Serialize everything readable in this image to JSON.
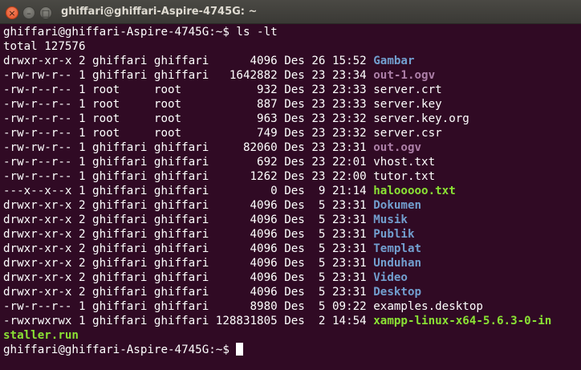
{
  "window": {
    "title": "ghiffari@ghiffari-Aspire-4745G: ~",
    "close_glyph": "×",
    "minimize_glyph": "–",
    "maximize_glyph": "□"
  },
  "colors": {
    "background": "#300a24",
    "text": "#ffffff",
    "directory": "#729fcf",
    "media": "#ad7fa8",
    "executable": "#8ae234"
  },
  "terminal": {
    "prompt": "ghiffari@ghiffari-Aspire-4745G:~$ ",
    "command_line": "ghiffari@ghiffari-Aspire-4745G:~$ ls -lt",
    "total_line": "total 127576",
    "rows": [
      {
        "info": "drwxr-xr-x 2 ghiffari ghiffari      4096 Des 26 15:52 ",
        "name": "Gambar",
        "kind": "dir"
      },
      {
        "info": "-rw-rw-r-- 1 ghiffari ghiffari   1642882 Des 23 23:34 ",
        "name": "out-1.ogv",
        "kind": "media"
      },
      {
        "info": "-rw-r--r-- 1 root     root           932 Des 23 23:33 ",
        "name": "server.crt",
        "kind": "plain"
      },
      {
        "info": "-rw-r--r-- 1 root     root           887 Des 23 23:33 ",
        "name": "server.key",
        "kind": "plain"
      },
      {
        "info": "-rw-r--r-- 1 root     root           963 Des 23 23:32 ",
        "name": "server.key.org",
        "kind": "plain"
      },
      {
        "info": "-rw-r--r-- 1 root     root           749 Des 23 23:32 ",
        "name": "server.csr",
        "kind": "plain"
      },
      {
        "info": "-rw-rw-r-- 1 ghiffari ghiffari     82060 Des 23 23:31 ",
        "name": "out.ogv",
        "kind": "media"
      },
      {
        "info": "-rw-r--r-- 1 ghiffari ghiffari       692 Des 23 22:01 ",
        "name": "vhost.txt",
        "kind": "plain"
      },
      {
        "info": "-rw-r--r-- 1 ghiffari ghiffari      1262 Des 23 22:00 ",
        "name": "tutor.txt",
        "kind": "plain"
      },
      {
        "info": "---x--x--x 1 ghiffari ghiffari         0 Des  9 21:14 ",
        "name": "halooooo.txt",
        "kind": "exec"
      },
      {
        "info": "drwxr-xr-x 2 ghiffari ghiffari      4096 Des  5 23:31 ",
        "name": "Dokumen",
        "kind": "dir"
      },
      {
        "info": "drwxr-xr-x 2 ghiffari ghiffari      4096 Des  5 23:31 ",
        "name": "Musik",
        "kind": "dir"
      },
      {
        "info": "drwxr-xr-x 2 ghiffari ghiffari      4096 Des  5 23:31 ",
        "name": "Publik",
        "kind": "dir"
      },
      {
        "info": "drwxr-xr-x 2 ghiffari ghiffari      4096 Des  5 23:31 ",
        "name": "Templat",
        "kind": "dir"
      },
      {
        "info": "drwxr-xr-x 2 ghiffari ghiffari      4096 Des  5 23:31 ",
        "name": "Unduhan",
        "kind": "dir"
      },
      {
        "info": "drwxr-xr-x 2 ghiffari ghiffari      4096 Des  5 23:31 ",
        "name": "Video",
        "kind": "dir"
      },
      {
        "info": "drwxr-xr-x 2 ghiffari ghiffari      4096 Des  5 23:31 ",
        "name": "Desktop",
        "kind": "dir"
      },
      {
        "info": "-rw-r--r-- 1 ghiffari ghiffari      8980 Des  5 09:22 ",
        "name": "examples.desktop",
        "kind": "plain"
      },
      {
        "info": "-rwxrwxrwx 1 ghiffari ghiffari 128831805 Des  2 14:54 ",
        "name": "xampp-linux-x64-5.6.3-0-in",
        "kind": "exec"
      }
    ],
    "wrapped_line": "staller.run",
    "final_prompt": "ghiffari@ghiffari-Aspire-4745G:~$ "
  }
}
